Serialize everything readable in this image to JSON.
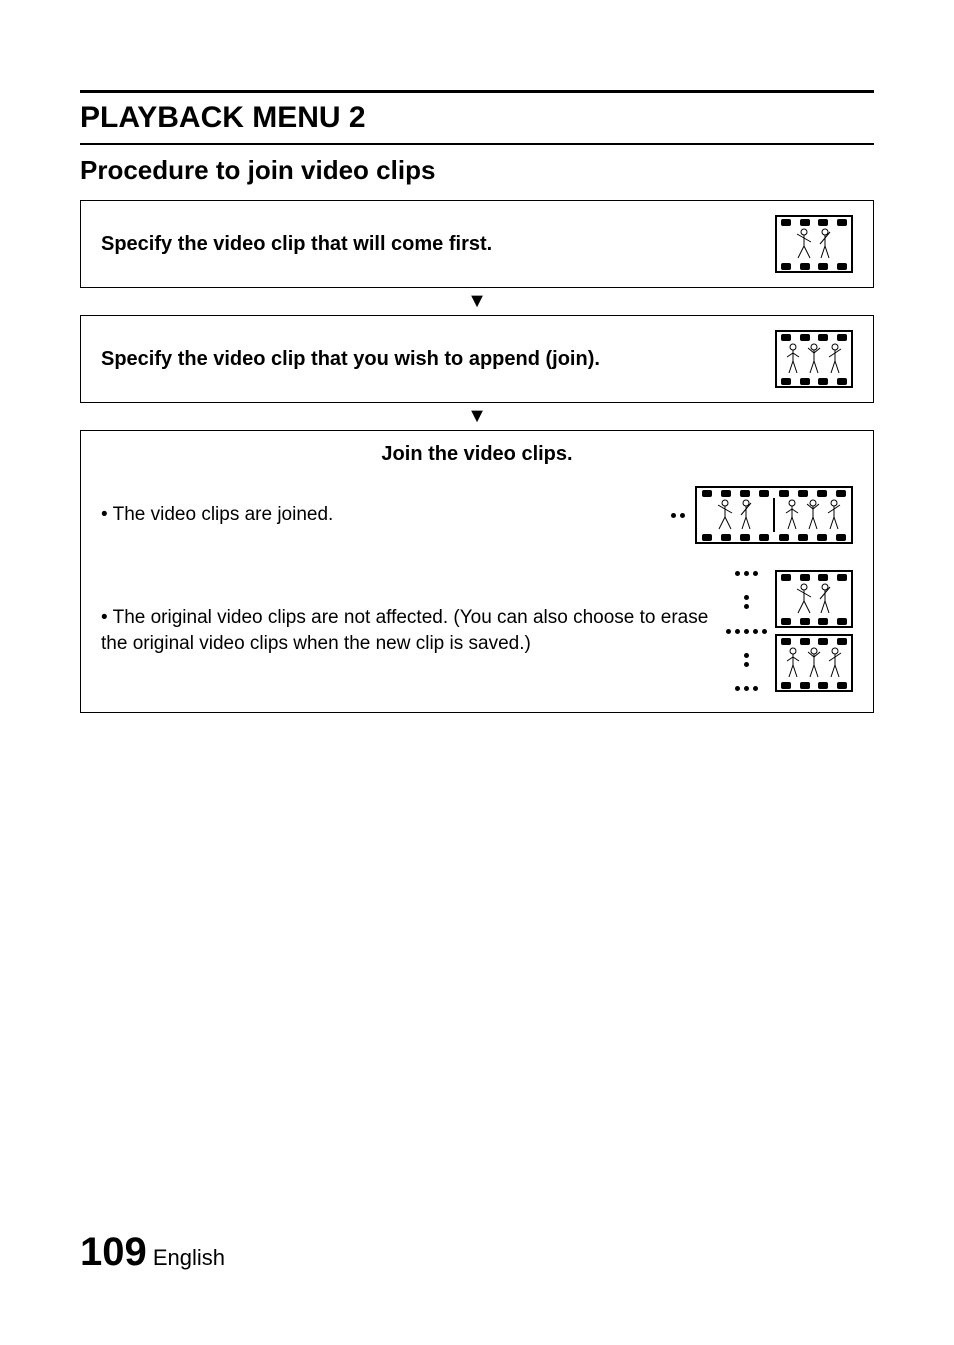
{
  "header": {
    "title": "PLAYBACK MENU 2",
    "subtitle": "Procedure to join video clips"
  },
  "steps": {
    "step1": "Specify the video clip that will come first.",
    "step2": "Specify the video clip that you wish to append (join).",
    "step3_title": "Join the video clips.",
    "bullet1": "The video clips are joined.",
    "bullet2": "The original video clips are not affected. (You can also choose to erase the original video clips when the new clip is saved.)"
  },
  "footer": {
    "page": "109",
    "lang": "English"
  },
  "icons": {
    "filmstrip_a": "dancer-clip-icon",
    "filmstrip_b": "group-clip-icon",
    "filmstrip_joined": "joined-clip-icon"
  }
}
